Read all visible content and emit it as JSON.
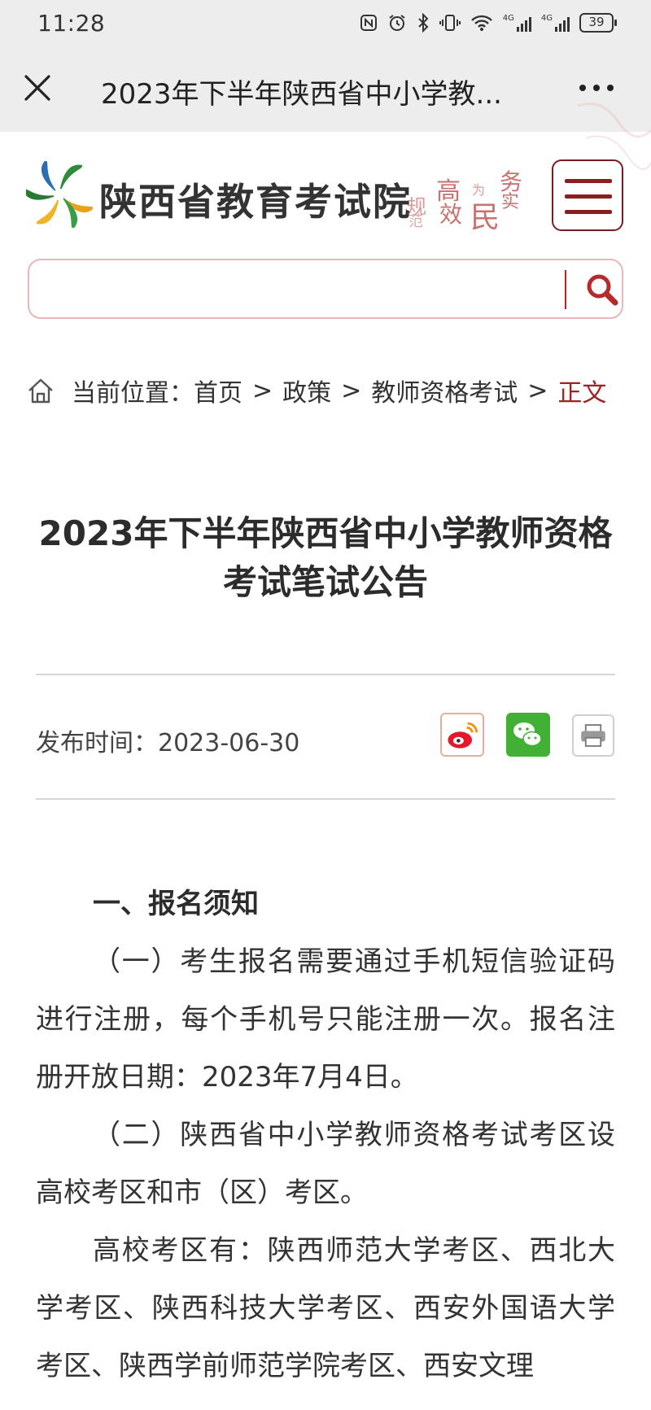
{
  "status_bar": {
    "time": "11:28",
    "battery": "39",
    "network_1": "4G",
    "network_2": "4G",
    "icons": [
      "nfc-icon",
      "alarm-icon",
      "bluetooth-icon",
      "vibrate-icon",
      "wifi-icon",
      "signal-icon",
      "battery-icon"
    ]
  },
  "title_bar": {
    "title": "2023年下半年陕西省中小学教..."
  },
  "header": {
    "site_name": "陕西省教育考试院",
    "motto": {
      "c1": "规",
      "c2": "范",
      "c3": "高",
      "c4": "效",
      "c5": "为",
      "c6": "民",
      "c7": "务",
      "c8": "实"
    }
  },
  "search": {
    "placeholder": ""
  },
  "breadcrumb": {
    "label": "当前位置：",
    "items": [
      "首页",
      "政策",
      "教师资格考试"
    ],
    "current": "正文",
    "separator": ">"
  },
  "article": {
    "title": "2023年下半年陕西省中小学教师资格考试笔试公告",
    "publish_label": "发布时间：",
    "publish_date": "2023-06-30",
    "section_1": "一、报名须知",
    "para_1": "（一）考生报名需要通过手机短信验证码进行注册，每个手机号只能注册一次。报名注册开放日期：2023年7月4日。",
    "para_2": "（二）陕西省中小学教师资格考试考区设高校考区和市（区）考区。",
    "para_3": "高校考区有：陕西师范大学考区、西北大学考区、陕西科技大学考区、西安外国语大学考区、陕西学前师范学院考区、西安文理"
  },
  "colors": {
    "accent": "#a02323",
    "search_border": "#e8b7b7",
    "bar_bg": "#ededed"
  }
}
